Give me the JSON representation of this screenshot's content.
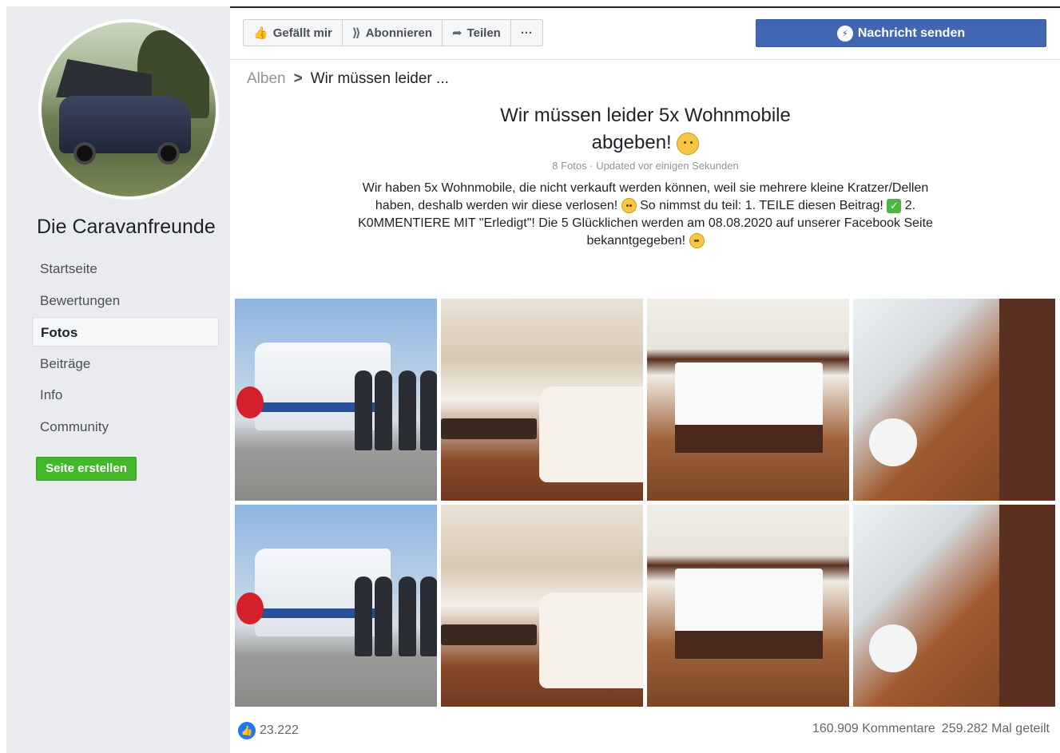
{
  "sidebar": {
    "page_name": "Die Caravanfreunde",
    "nav": [
      {
        "label": "Startseite",
        "active": false
      },
      {
        "label": "Bewertungen",
        "active": false
      },
      {
        "label": "Fotos",
        "active": true
      },
      {
        "label": "Beiträge",
        "active": false
      },
      {
        "label": "Info",
        "active": false
      },
      {
        "label": "Community",
        "active": false
      }
    ],
    "create_button": "Seite erstellen"
  },
  "actions": {
    "like": "Gefällt mir",
    "follow": "Abonnieren",
    "share": "Teilen",
    "more": "···",
    "message": "Nachricht senden"
  },
  "breadcrumb": {
    "root": "Alben",
    "separator": ">",
    "current": "Wir müssen leider ..."
  },
  "album": {
    "title_line1": "Wir müssen leider 5x Wohnmobile",
    "title_line2": "abgeben!",
    "meta": "8 Fotos · Updated vor einigen Sekunden",
    "description_part1": "Wir haben 5x Wohnmobile, die nicht verkauft werden können, weil sie mehrere kleine Kratzer/Dellen haben, deshalb werden wir diese verlosen!",
    "description_part2": "So nimmst du teil: 1. TEILE diesen Beitrag!",
    "description_part3": "2. K0MMENTIERE MIT \"Erledigt\"! Die 5 Glücklichen werden am 08.08.2020 auf unserer Facebook Seite bekanntgegeben!"
  },
  "photos": [
    {
      "kind": "exterior"
    },
    {
      "kind": "living"
    },
    {
      "kind": "bedroom"
    },
    {
      "kind": "bath"
    },
    {
      "kind": "exterior"
    },
    {
      "kind": "living"
    },
    {
      "kind": "bedroom"
    },
    {
      "kind": "bath"
    }
  ],
  "footer": {
    "likes": "23.222",
    "comments": "160.909 Kommentare",
    "shares": "259.282 Mal geteilt"
  },
  "colors": {
    "sidebar_bg": "#e9ebee",
    "messenger_blue": "#4267b2",
    "create_green": "#42b72a",
    "like_blue": "#2078f4"
  }
}
